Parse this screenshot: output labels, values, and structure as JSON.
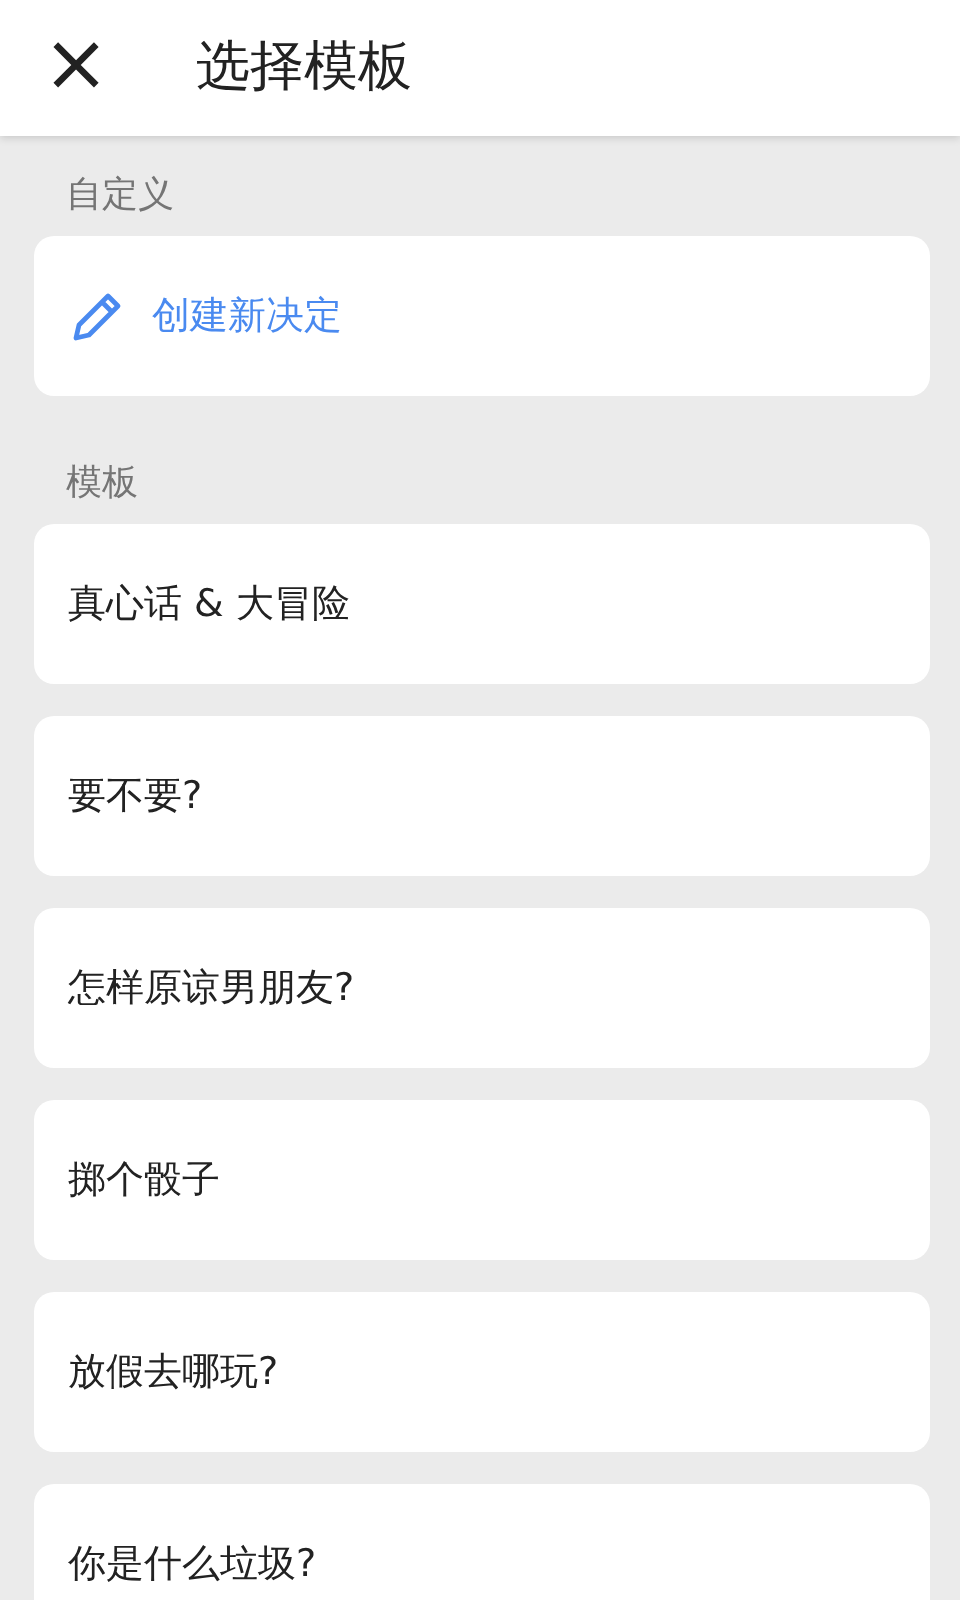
{
  "header": {
    "close": "×",
    "title": "选择模板"
  },
  "sections": [
    {
      "label": "自定义",
      "items": [
        {
          "kind": "create",
          "text": "创建新决定"
        }
      ]
    },
    {
      "label": "模板",
      "items": [
        {
          "kind": "template",
          "text": "真心话 & 大冒险"
        },
        {
          "kind": "template",
          "text": "要不要?"
        },
        {
          "kind": "template",
          "text": "怎样原谅男朋友?"
        },
        {
          "kind": "template",
          "text": "掷个骰子"
        },
        {
          "kind": "template",
          "text": "放假去哪玩?"
        },
        {
          "kind": "template",
          "text": "你是什么垃圾?"
        }
      ]
    }
  ]
}
